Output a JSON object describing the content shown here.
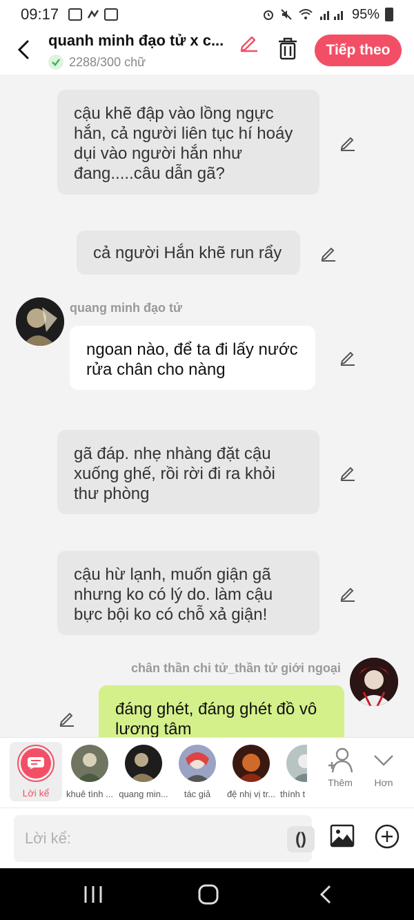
{
  "status": {
    "time": "09:17",
    "battery": "95%"
  },
  "header": {
    "title": "quanh minh đạo tử x c...",
    "word_count": "2288/300 chữ",
    "next_label": "Tiếp theo",
    "accent": "#f24f66"
  },
  "messages": [
    {
      "type": "narration",
      "text": "cậu khẽ đập vào lồng ngực hắn, cả người liên tục hí hoáy dụi vào người hắn như đang.....câu dẫn gã?"
    },
    {
      "type": "narration",
      "text": "cả người Hắn khẽ run rẩy"
    },
    {
      "type": "character",
      "name": "quang minh đạo tử",
      "text": "ngoan nào, để ta đi lấy nước rửa chân cho nàng"
    },
    {
      "type": "narration",
      "text": "gã đáp. nhẹ nhàng đặt cậu xuống ghế, rồi rời đi ra khỏi thư phòng"
    },
    {
      "type": "narration",
      "text": "cậu hừ lạnh, muốn giận gã nhưng ko có lý do. làm cậu bực bội ko có chỗ xả giận!"
    },
    {
      "type": "self",
      "name": "chân thần chi tử_thần tử giới ngoại",
      "text": "đáng ghét, đáng ghét đồ vô lương tâm"
    }
  ],
  "characters": [
    {
      "label": "Lời kể",
      "icon": "narrator-icon"
    },
    {
      "label": "khuê tình ..."
    },
    {
      "label": "quang min..."
    },
    {
      "label": "tác giả"
    },
    {
      "label": "đệ nhị vị tr..."
    },
    {
      "label": "thính t"
    }
  ],
  "actions": {
    "add_label": "Thêm",
    "more_label": "Hơn"
  },
  "input": {
    "placeholder": "Lời kể:",
    "paren": "()"
  }
}
